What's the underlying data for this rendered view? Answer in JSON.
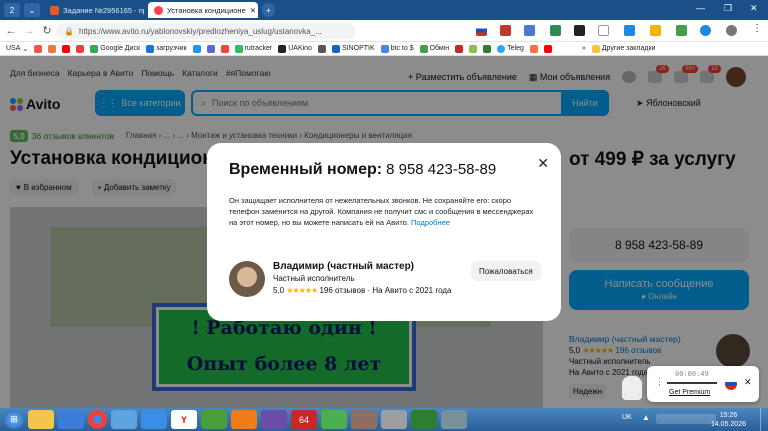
{
  "browser": {
    "tab_count": "2",
    "tabs": [
      {
        "label": "Задание №2956165 - про",
        "active": false
      },
      {
        "label": "Установка кондиционе",
        "active": true
      }
    ],
    "url": "https://www.avito.ru/yablonovskiy/predlozheniya_uslug/ustanovka_..."
  },
  "bookmarks": [
    "USA",
    "Google Диск",
    "загрузчик",
    "rutracker",
    "UAKino",
    "SINOPTIK",
    "btc to $",
    "Обмін",
    "Teleg",
    "Другие закладки"
  ],
  "topnav": {
    "items": [
      "Для бизнеса",
      "Карьера в Авито",
      "Помощь",
      "Каталоги",
      "#яПомогаю"
    ],
    "post_ad": "Разместить объявление",
    "my_ads": "Мои объявления",
    "badges": [
      "26",
      "99+",
      "15"
    ]
  },
  "header": {
    "logo": "Avito",
    "categories_button": "Все категории",
    "search_placeholder": "Поиск по объявлениям",
    "search_button": "Найти",
    "location": "Яблоновский"
  },
  "listing": {
    "rating_score": "5,0",
    "rating_text": "36 отзывов клиентов",
    "breadcrumbs": "Главная › ... › ... › Монтаж и установка техники › Кондиционеры и вентиляция",
    "title": "Установка кондицион",
    "price": "от 499 ₽ за услугу",
    "favorite": "В избранном",
    "note": "Добавить заметку",
    "sign_line1": "! Работаю один !",
    "sign_line2": "Опыт более 8 лет",
    "phone": "8 958 423-58-89",
    "message_button": "Написать сообщение",
    "online": "Онлайн",
    "seller_name": "Владимир (частный мастер)",
    "seller_rating": "5,0",
    "seller_reviews": "196 отзывов",
    "seller_type": "Частный исполнитель",
    "seller_since": "На Авито с 2021 года",
    "reliable": "Надежн"
  },
  "modal": {
    "title": "Временный номер:",
    "number": "8 958 423-58-89",
    "text": "Он защищает исполнителя от нежелательных звонков. Не сохраняйте его: скоро телефон заменится на другой. Компания не получит смс и сообщения в мессенджерах на этот номер, но вы можете написать ей на Авито.",
    "more_link": "Подробнее",
    "seller_name": "Владимир (частный мастер)",
    "seller_type": "Частный исполнитель",
    "rating": "5,0",
    "reviews": "196 отзывов",
    "since": "На Авито с 2021 года",
    "complain_button": "Пожаловаться"
  },
  "recorder": {
    "time": "00:00:49",
    "premium": "Get Premium"
  },
  "taskbar": {
    "lang": "UK",
    "time": "15:26",
    "date": "14.05.2026"
  }
}
